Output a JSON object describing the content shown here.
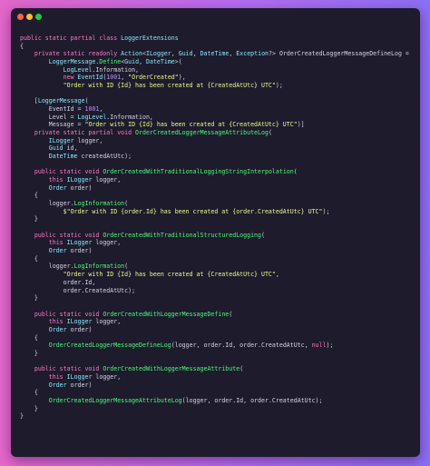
{
  "window": {
    "controls": [
      "close",
      "minimize",
      "maximize"
    ]
  },
  "colors": {
    "keyword": "#ff79c6",
    "type": "#8be9fd",
    "method": "#50fa7b",
    "string": "#f1fa8c",
    "number": "#bd93f9",
    "plain": "#d6d6e7",
    "background": "#1d1b2c"
  },
  "code": {
    "lines": [
      [
        [
          "kw",
          "public static partial class "
        ],
        [
          "ty",
          "LoggerExtensions"
        ]
      ],
      [
        [
          "pl",
          "{"
        ]
      ],
      [
        [
          "pl",
          "    "
        ],
        [
          "kw",
          "private static readonly "
        ],
        [
          "ty",
          "Action"
        ],
        [
          "pl",
          "<"
        ],
        [
          "ty",
          "ILogger"
        ],
        [
          "pl",
          ", "
        ],
        [
          "ty",
          "Guid"
        ],
        [
          "pl",
          ", "
        ],
        [
          "ty",
          "DateTime"
        ],
        [
          "pl",
          ", "
        ],
        [
          "ty",
          "Exception"
        ],
        [
          "pl",
          "?> "
        ],
        [
          "pl",
          "OrderCreatedLoggerMessageDefineLog ="
        ]
      ],
      [
        [
          "pl",
          "        "
        ],
        [
          "ty",
          "LoggerMessage"
        ],
        [
          "pl",
          "."
        ],
        [
          "fn",
          "Define"
        ],
        [
          "pl",
          "<"
        ],
        [
          "ty",
          "Guid"
        ],
        [
          "pl",
          ", "
        ],
        [
          "ty",
          "DateTime"
        ],
        [
          "pl",
          ">("
        ]
      ],
      [
        [
          "pl",
          "            "
        ],
        [
          "ty",
          "LogLevel"
        ],
        [
          "pl",
          ".Information,"
        ]
      ],
      [
        [
          "pl",
          "            "
        ],
        [
          "kw",
          "new "
        ],
        [
          "ty",
          "EventId"
        ],
        [
          "pl",
          "("
        ],
        [
          "num",
          "1001"
        ],
        [
          "pl",
          ", "
        ],
        [
          "str",
          "\"OrderCreated\""
        ],
        [
          "pl",
          "),"
        ]
      ],
      [
        [
          "pl",
          "            "
        ],
        [
          "str",
          "\"Order with ID {Id} has been created at {CreatedAtUtc} UTC\""
        ],
        [
          "pl",
          ");"
        ]
      ],
      [
        [
          "pl",
          ""
        ]
      ],
      [
        [
          "pl",
          "    ["
        ],
        [
          "attr",
          "LoggerMessage"
        ],
        [
          "pl",
          "("
        ]
      ],
      [
        [
          "pl",
          "        EventId = "
        ],
        [
          "num",
          "1001"
        ],
        [
          "pl",
          ","
        ]
      ],
      [
        [
          "pl",
          "        Level = "
        ],
        [
          "ty",
          "LogLevel"
        ],
        [
          "pl",
          ".Information,"
        ]
      ],
      [
        [
          "pl",
          "        Message = "
        ],
        [
          "str",
          "\"Order with ID {Id} has been created at {CreatedAtUtc} UTC\""
        ],
        [
          "pl",
          ")]"
        ]
      ],
      [
        [
          "pl",
          "    "
        ],
        [
          "kw",
          "private static partial void "
        ],
        [
          "fn",
          "OrderCreatedLoggerMessageAttributeLog"
        ],
        [
          "pl",
          "("
        ]
      ],
      [
        [
          "pl",
          "        "
        ],
        [
          "ty",
          "ILogger"
        ],
        [
          "pl",
          " logger,"
        ]
      ],
      [
        [
          "pl",
          "        "
        ],
        [
          "ty",
          "Guid"
        ],
        [
          "pl",
          " id,"
        ]
      ],
      [
        [
          "pl",
          "        "
        ],
        [
          "ty",
          "DateTime"
        ],
        [
          "pl",
          " createdAtUtc);"
        ]
      ],
      [
        [
          "pl",
          ""
        ]
      ],
      [
        [
          "pl",
          "    "
        ],
        [
          "kw",
          "public static void "
        ],
        [
          "fn",
          "OrderCreatedWithTraditionalLoggingStringInterpolation"
        ],
        [
          "pl",
          "("
        ]
      ],
      [
        [
          "pl",
          "        "
        ],
        [
          "kw",
          "this "
        ],
        [
          "ty",
          "ILogger"
        ],
        [
          "pl",
          " logger,"
        ]
      ],
      [
        [
          "pl",
          "        "
        ],
        [
          "ty",
          "Order"
        ],
        [
          "pl",
          " order)"
        ]
      ],
      [
        [
          "pl",
          "    {"
        ]
      ],
      [
        [
          "pl",
          "        logger."
        ],
        [
          "fn",
          "LogInformation"
        ],
        [
          "pl",
          "("
        ]
      ],
      [
        [
          "pl",
          "            "
        ],
        [
          "str",
          "$\"Order with ID {order.Id} has been created at {order.CreatedAtUtc} UTC\""
        ],
        [
          "pl",
          ");"
        ]
      ],
      [
        [
          "pl",
          "    }"
        ]
      ],
      [
        [
          "pl",
          ""
        ]
      ],
      [
        [
          "pl",
          "    "
        ],
        [
          "kw",
          "public static void "
        ],
        [
          "fn",
          "OrderCreatedWithTraditionalStructuredLogging"
        ],
        [
          "pl",
          "("
        ]
      ],
      [
        [
          "pl",
          "        "
        ],
        [
          "kw",
          "this "
        ],
        [
          "ty",
          "ILogger"
        ],
        [
          "pl",
          " logger,"
        ]
      ],
      [
        [
          "pl",
          "        "
        ],
        [
          "ty",
          "Order"
        ],
        [
          "pl",
          " order)"
        ]
      ],
      [
        [
          "pl",
          "    {"
        ]
      ],
      [
        [
          "pl",
          "        logger."
        ],
        [
          "fn",
          "LogInformation"
        ],
        [
          "pl",
          "("
        ]
      ],
      [
        [
          "pl",
          "            "
        ],
        [
          "str",
          "\"Order with ID {Id} has been created at {CreatedAtUtc} UTC\""
        ],
        [
          "pl",
          ","
        ]
      ],
      [
        [
          "pl",
          "            order.Id,"
        ]
      ],
      [
        [
          "pl",
          "            order.CreatedAtUtc);"
        ]
      ],
      [
        [
          "pl",
          "    }"
        ]
      ],
      [
        [
          "pl",
          ""
        ]
      ],
      [
        [
          "pl",
          "    "
        ],
        [
          "kw",
          "public static void "
        ],
        [
          "fn",
          "OrderCreatedWithLoggerMessageDefine"
        ],
        [
          "pl",
          "("
        ]
      ],
      [
        [
          "pl",
          "        "
        ],
        [
          "kw",
          "this "
        ],
        [
          "ty",
          "ILogger"
        ],
        [
          "pl",
          " logger,"
        ]
      ],
      [
        [
          "pl",
          "        "
        ],
        [
          "ty",
          "Order"
        ],
        [
          "pl",
          " order)"
        ]
      ],
      [
        [
          "pl",
          "    {"
        ]
      ],
      [
        [
          "pl",
          "        "
        ],
        [
          "fn",
          "OrderCreatedLoggerMessageDefineLog"
        ],
        [
          "pl",
          "(logger, order.Id, order.CreatedAtUtc, "
        ],
        [
          "kw",
          "null"
        ],
        [
          "pl",
          ");"
        ]
      ],
      [
        [
          "pl",
          "    }"
        ]
      ],
      [
        [
          "pl",
          ""
        ]
      ],
      [
        [
          "pl",
          "    "
        ],
        [
          "kw",
          "public static void "
        ],
        [
          "fn",
          "OrderCreatedWithLoggerMessageAttribute"
        ],
        [
          "pl",
          "("
        ]
      ],
      [
        [
          "pl",
          "        "
        ],
        [
          "kw",
          "this "
        ],
        [
          "ty",
          "ILogger"
        ],
        [
          "pl",
          " logger,"
        ]
      ],
      [
        [
          "pl",
          "        "
        ],
        [
          "ty",
          "Order"
        ],
        [
          "pl",
          " order)"
        ]
      ],
      [
        [
          "pl",
          "    {"
        ]
      ],
      [
        [
          "pl",
          "        "
        ],
        [
          "fn",
          "OrderCreatedLoggerMessageAttributeLog"
        ],
        [
          "pl",
          "(logger, order.Id, order.CreatedAtUtc);"
        ]
      ],
      [
        [
          "pl",
          "    }"
        ]
      ],
      [
        [
          "pl",
          "}"
        ]
      ]
    ]
  }
}
